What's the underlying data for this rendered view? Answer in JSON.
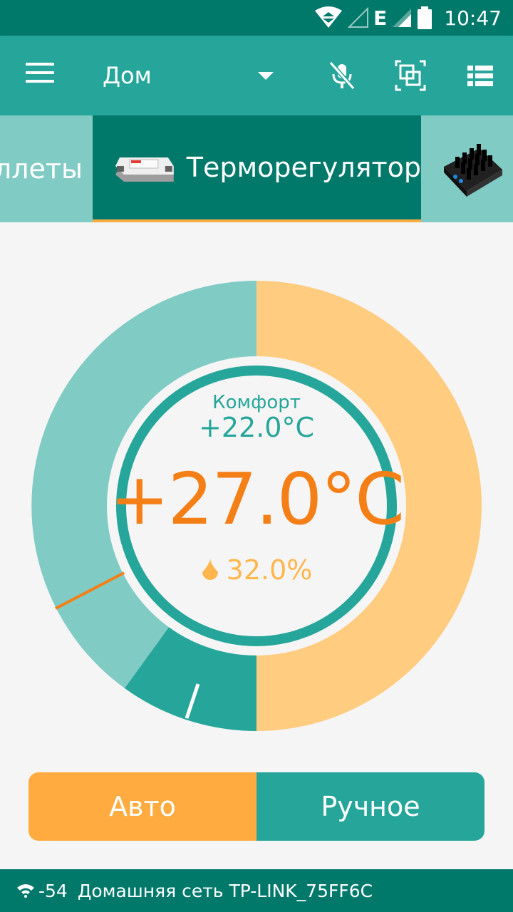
{
  "status_bar": {
    "time": "10:47",
    "network_type": "E"
  },
  "app_bar": {
    "location": "Дом",
    "icons": [
      "menu-icon",
      "mic-off-icon",
      "layers-icon",
      "list-icon"
    ]
  },
  "tabs": [
    {
      "label": "ллеты"
    },
    {
      "label": "Терморегулятор",
      "active": true
    },
    {
      "label": ""
    }
  ],
  "thermostat": {
    "comfort_label": "Комфорт",
    "comfort_temp": "+22.0°C",
    "current_temp": "+27.0°C",
    "humidity": "32.0%",
    "colors": {
      "heat": "#ffcc80",
      "cool": "#80cbc4",
      "dark": "#26a69a",
      "accent": "#f57f17"
    }
  },
  "modes": {
    "auto": "Авто",
    "manual": "Ручное",
    "selected": "auto"
  },
  "footer": {
    "signal": "-54",
    "network_name": "Домашняя сеть TP-LINK_75FF6C"
  }
}
